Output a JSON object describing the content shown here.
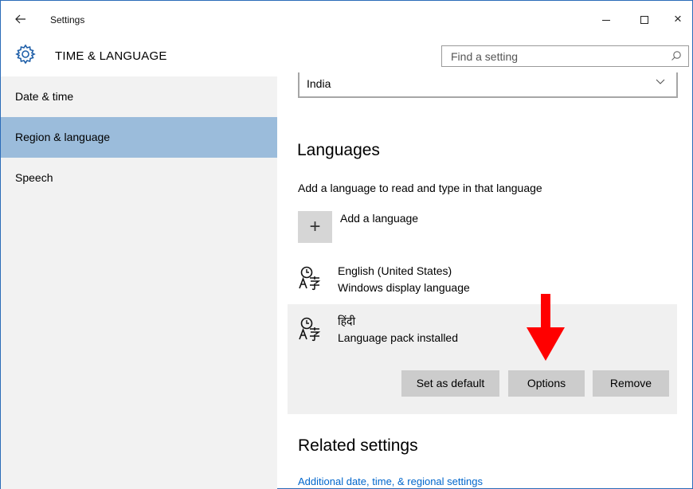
{
  "window": {
    "title": "Settings",
    "back_icon": "arrow-left-icon",
    "controls": {
      "minimize": "minimize-icon",
      "maximize": "maximize-icon",
      "close_glyph": "×"
    }
  },
  "header": {
    "section_title": "TIME & LANGUAGE",
    "section_icon": "gear-icon",
    "search": {
      "placeholder": "Find a setting",
      "icon": "search-icon"
    }
  },
  "sidebar": {
    "items": [
      {
        "label": "Date & time",
        "selected": false
      },
      {
        "label": "Region & language",
        "selected": true
      },
      {
        "label": "Speech",
        "selected": false
      }
    ]
  },
  "main": {
    "country_select": {
      "value": "India"
    },
    "languages_heading": "Languages",
    "languages_description": "Add a language to read and type in that language",
    "add_language": {
      "icon_glyph": "+",
      "label": "Add a language"
    },
    "languages": [
      {
        "name": "English (United States)",
        "status": "Windows display language",
        "icon": "language-icon"
      },
      {
        "name": "हिंदी",
        "status": "Language pack installed",
        "icon": "language-icon",
        "selected": true
      }
    ],
    "actions": {
      "set_default": "Set as default",
      "options": "Options",
      "remove": "Remove"
    },
    "related_heading": "Related settings",
    "related_link": "Additional date, time, & regional settings"
  },
  "colors": {
    "sidebar_bg": "#f2f2f2",
    "sidebar_selected": "#9bbcdb",
    "button_bg": "#cccccc",
    "highlight_arrow": "#ff0000",
    "link": "#0066cc"
  }
}
